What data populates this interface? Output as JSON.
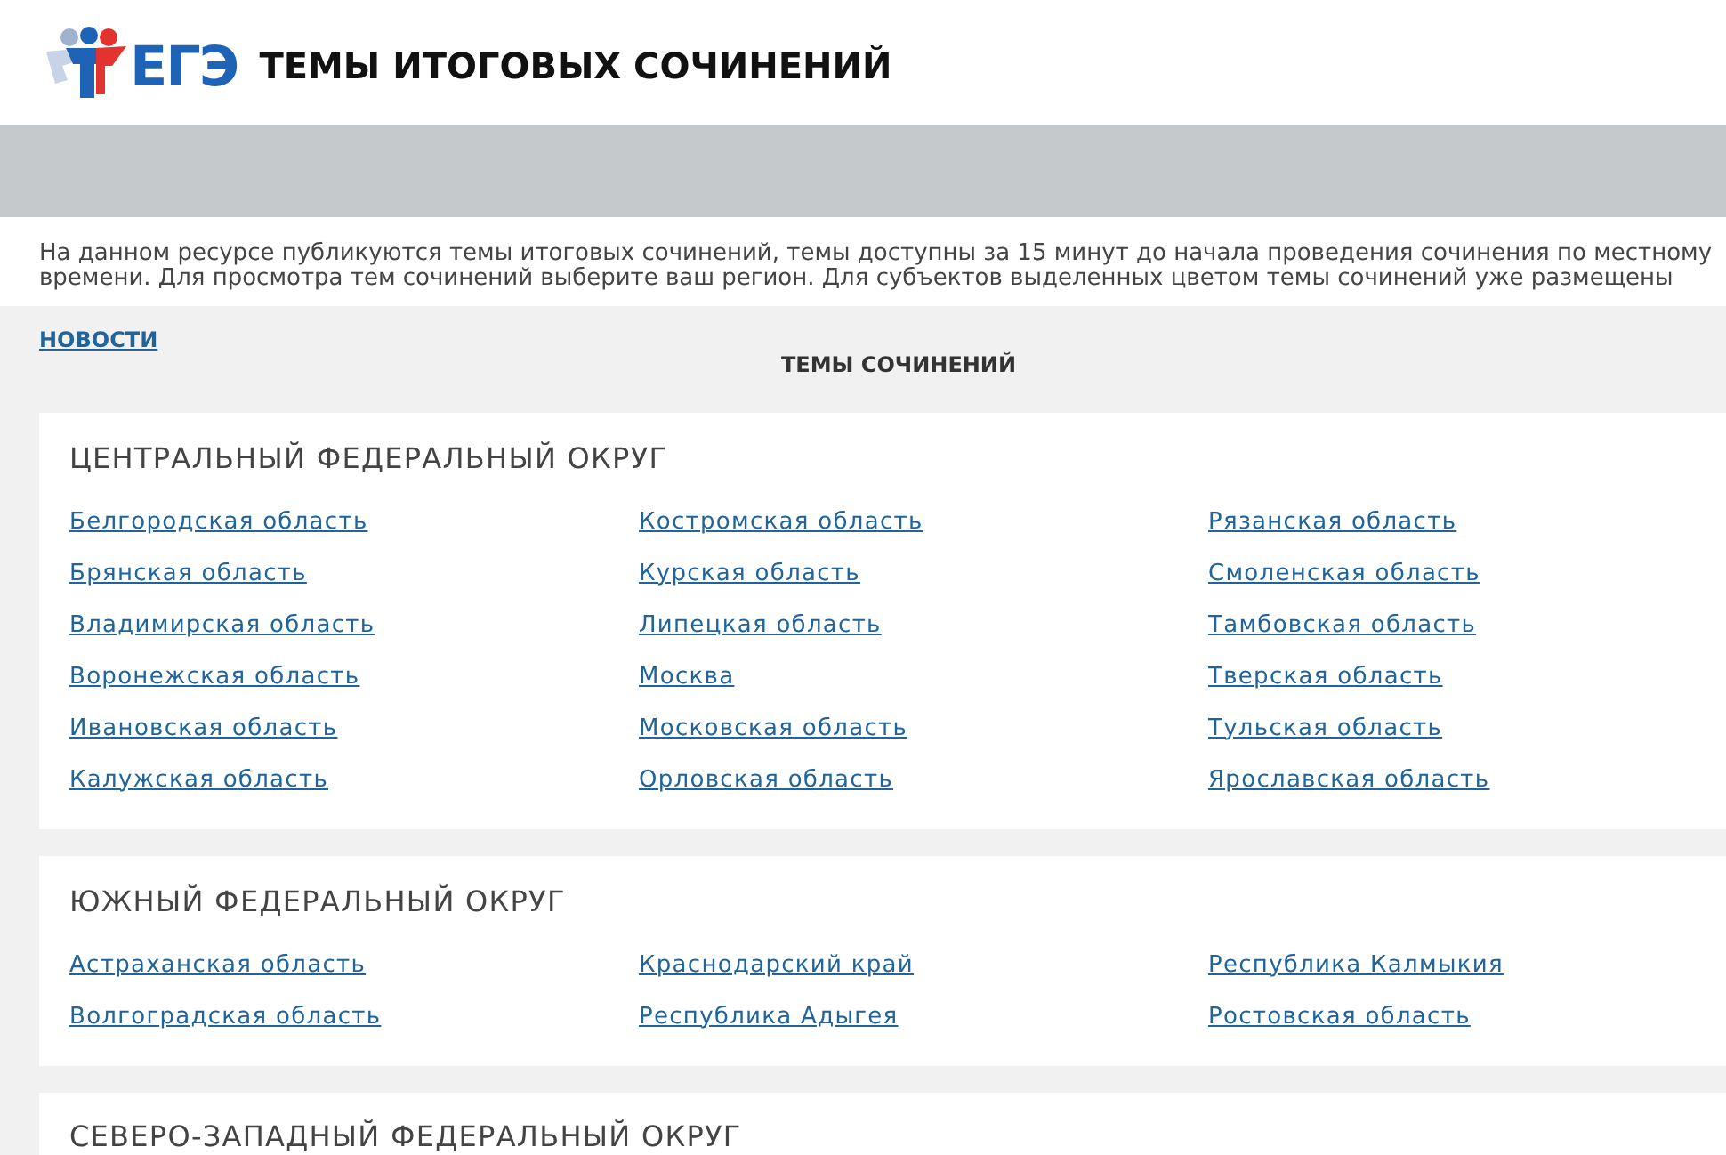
{
  "header": {
    "logo_text": "ЕГЭ",
    "title": "ТЕМЫ ИТОГОВЫХ СОЧИНЕНИЙ"
  },
  "intro": "На данном ресурсе публикуются темы итоговых сочинений, темы доступны за 15 минут до начала проведения сочинения по местному времени. Для просмотра тем сочинений выберите ваш регион. Для субъектов выделенных цветом темы сочинений уже размещены",
  "news_link": "НОВОСТИ",
  "section_title": "ТЕМЫ СОЧИНЕНИЙ",
  "districts": [
    {
      "name": "ЦЕНТРАЛЬНЫЙ ФЕДЕРАЛЬНЫЙ ОКРУГ",
      "regions": [
        "Белгородская область",
        "Брянская область",
        "Владимирская область",
        "Воронежская область",
        "Ивановская область",
        "Калужская область",
        "Костромская область",
        "Курская область",
        "Липецкая область",
        "Москва",
        "Московская область",
        "Орловская область",
        "Рязанская область",
        "Смоленская область",
        "Тамбовская область",
        "Тверская область",
        "Тульская область",
        "Ярославская область"
      ]
    },
    {
      "name": "ЮЖНЫЙ ФЕДЕРАЛЬНЫЙ ОКРУГ",
      "regions": [
        "Астраханская область",
        "Волгоградская область",
        "Краснодарский край",
        "Республика Адыгея",
        "Республика Калмыкия",
        "Ростовская область"
      ]
    },
    {
      "name": "СЕВЕРО-ЗАПАДНЫЙ ФЕДЕРАЛЬНЫЙ ОКРУГ"
    }
  ]
}
